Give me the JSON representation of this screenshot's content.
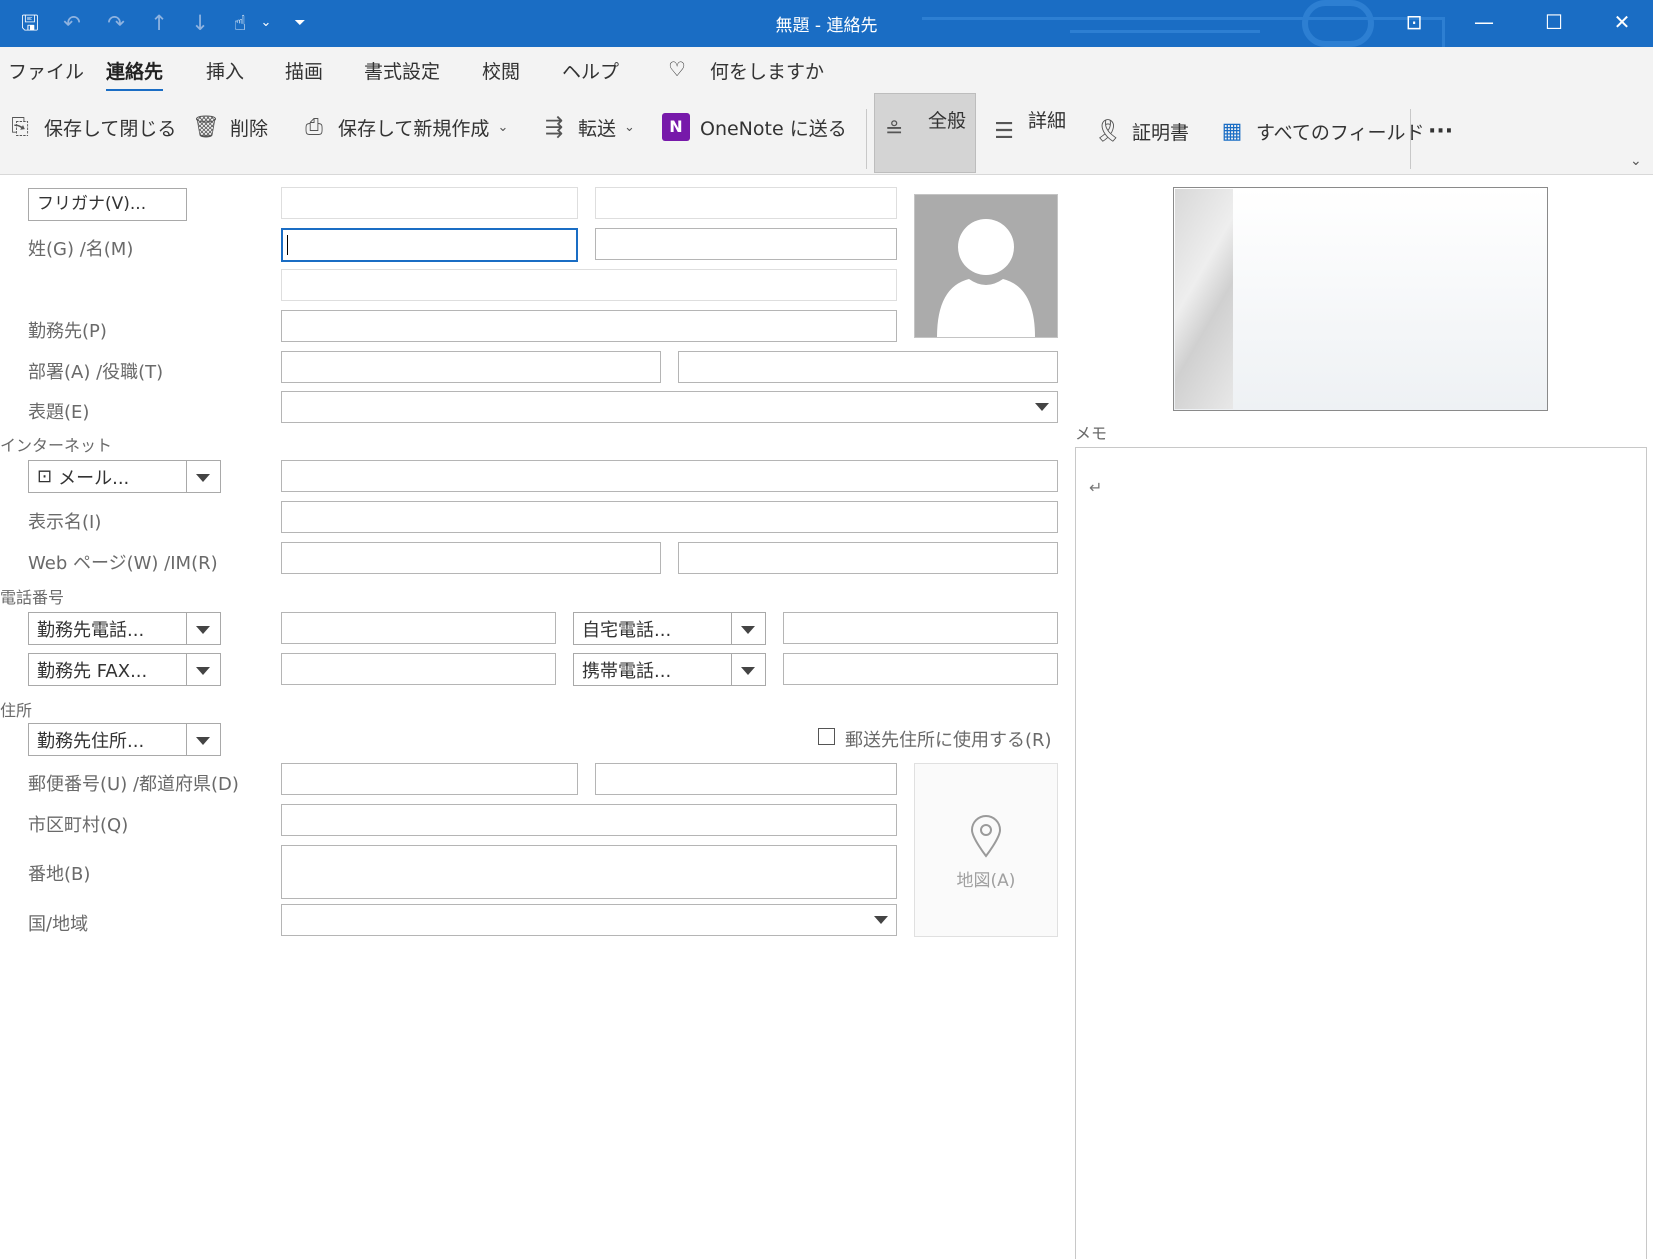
{
  "window": {
    "title": "無題 - 連絡先",
    "qat_icons": [
      "save-icon",
      "undo-icon",
      "redo-icon",
      "up-arrow-icon",
      "down-arrow-icon",
      "touch-mode-icon",
      "chevron-down-icon",
      "customize-qat-icon"
    ],
    "controls": [
      "ribbon-display-icon",
      "minimize-icon",
      "maximize-icon",
      "close-icon"
    ]
  },
  "menu": {
    "items": [
      "ファイル",
      "連絡先",
      "挿入",
      "描画",
      "書式設定",
      "校閲",
      "ヘルプ"
    ],
    "active": "連絡先",
    "tell_me": "何をしますか"
  },
  "ribbon": {
    "save_close": "保存して閉じる",
    "delete": "削除",
    "save_new": "保存して新規作成",
    "forward": "転送",
    "onenote": "OneNote に送る",
    "general": "全般",
    "details": "詳細",
    "certificates": "証明書",
    "all_fields": "すべてのフィールド",
    "more": "···"
  },
  "form": {
    "furigana_button": "フリガナ(V)...",
    "name_label": "姓(G) /名(M)",
    "company_label": "勤務先(P)",
    "dept_title_label": "部署(A) /役職(T)",
    "file_as_label": "表題(E)",
    "internet_section": "インターネット",
    "email_button": "メール...",
    "display_name_label": "表示名(I)",
    "web_im_label": "Web ページ(W) /IM(R)",
    "phone_section": "電話番号",
    "phone_business": "勤務先電話...",
    "phone_home": "自宅電話...",
    "phone_business_fax": "勤務先 FAX...",
    "phone_mobile": "携帯電話...",
    "address_section": "住所",
    "address_button": "勤務先住所...",
    "mailing_checkbox": "郵送先住所に使用する(R)",
    "postal_pref_label": "郵便番号(U) /都道府県(D)",
    "city_label": "市区町村(Q)",
    "street_label": "番地(B)",
    "country_label": "国/地域",
    "map_button": "地図(A)",
    "memo_label": "メモ",
    "memo_mark": "↵"
  }
}
